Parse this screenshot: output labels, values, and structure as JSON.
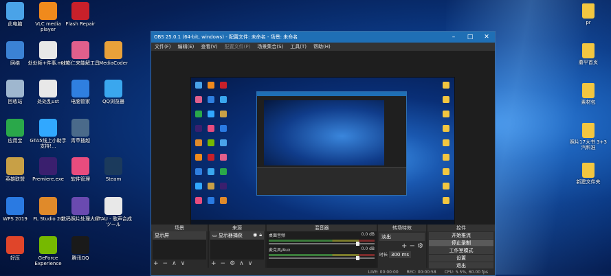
{
  "desktop": {
    "left_icons": [
      {
        "label": "此电脑",
        "color": "#4aa3e8"
      },
      {
        "label": "VLC media player",
        "color": "#f08a1c"
      },
      {
        "label": "Flash Repair",
        "color": "#c8202a"
      },
      {
        "label": "网络",
        "color": "#3b82d4"
      },
      {
        "label": "处处频+件事.mp3",
        "color": "#e8e8e8"
      },
      {
        "label": "咔嘭仁来能解工具",
        "color": "#e15f8c"
      },
      {
        "label": "MediaCoder",
        "color": "#e9a13a"
      },
      {
        "label": "回收站",
        "color": "#9fb7cf"
      },
      {
        "label": "处处乱ust",
        "color": "#e8e8e8"
      },
      {
        "label": "电脑管家",
        "color": "#2f7fe0"
      },
      {
        "label": "QQ浏览器",
        "color": "#3aa7ee"
      },
      {
        "label": "应用宝",
        "color": "#2aa84a"
      },
      {
        "label": "GTA5线上小助手 支持!...",
        "color": "#31a8ff"
      },
      {
        "label": "青苹插越",
        "color": "#4a6a8a"
      },
      {
        "label": "英雄联盟",
        "color": "#c8a046"
      },
      {
        "label": "Premiere.exe",
        "color": "#3a1f6e"
      },
      {
        "label": "软件管理",
        "color": "#e84c7e"
      },
      {
        "label": "Steam",
        "color": "#1b3a5c"
      },
      {
        "label": "WPS 2019",
        "color": "#2a7ae2"
      },
      {
        "label": "FL Studio 20",
        "color": "#e08a2a"
      },
      {
        "label": "数码照片处理大师",
        "color": "#6a4ab0"
      },
      {
        "label": "UTAU - 歌声合成ツール",
        "color": "#e8e8e8"
      },
      {
        "label": "好压",
        "color": "#e0452a"
      },
      {
        "label": "GeForce Experience",
        "color": "#76b900"
      },
      {
        "label": "腾讯QQ",
        "color": "#1a1a1a"
      }
    ],
    "right_icons": [
      {
        "label": "pr"
      },
      {
        "label": "蘑平首页"
      },
      {
        "label": "素材包"
      },
      {
        "label": "照片17大书 3+3汽料准"
      },
      {
        "label": "新建文件夹"
      }
    ]
  },
  "obs": {
    "title": "OBS 25.0.1 (64-bit, windows) - 配置文件: 未命名 - 场景: 未命名",
    "menu": [
      "文件(F)",
      "编辑(E)",
      "查看(V)",
      "配置文件(P)",
      "场景集合(S)",
      "工具(T)",
      "帮助(H)"
    ],
    "menu_disabled_index": 3,
    "docks": {
      "scenes": {
        "title": "场景",
        "items": [
          "显示屏"
        ]
      },
      "sources": {
        "title": "来源",
        "items": [
          "显示器捕获"
        ]
      },
      "mixer": {
        "title": "混音器",
        "channels": [
          {
            "name": "桌面音频",
            "db": "0.0 dB"
          },
          {
            "name": "麦克风/Aux",
            "db": "0.0 dB"
          }
        ]
      },
      "transitions": {
        "title": "转场特效",
        "selected": "淡出",
        "duration_label": "时长",
        "duration_value": "300 ms"
      },
      "controls": {
        "title": "控件",
        "buttons": [
          "开始推流",
          "停止录制",
          "工作室模式",
          "设置",
          "退出"
        ],
        "active_index": 1
      }
    },
    "status": {
      "live": "LIVE: 00:00:00",
      "rec": "REC: 00:00:58",
      "cpu": "CPU: 5.5%, 60.00 fps"
    }
  }
}
